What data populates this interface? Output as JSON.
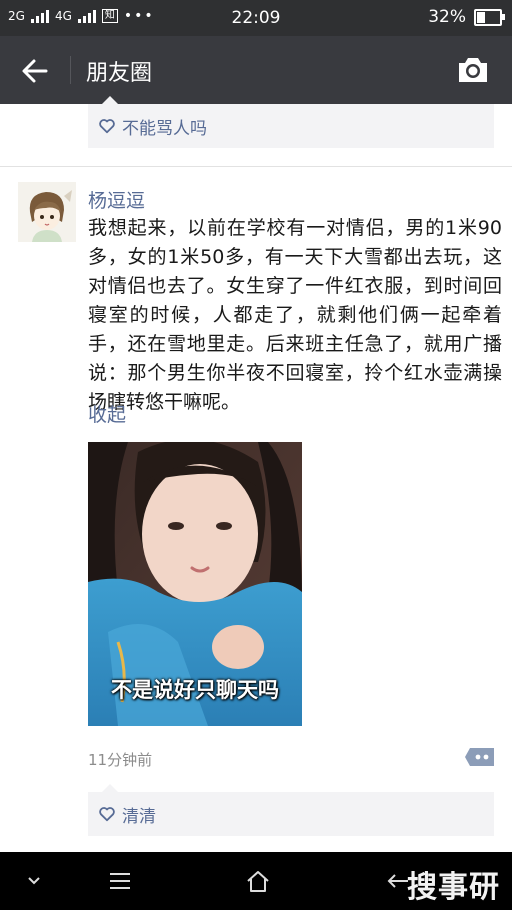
{
  "status_bar": {
    "network_1": "2G",
    "network_2": "4G",
    "network_2_sub": "4G",
    "app_badge": "知",
    "dots": "•••",
    "time": "22:09",
    "battery_text": "32%",
    "battery_level": 0.32
  },
  "nav": {
    "title": "朋友圈"
  },
  "previous_post": {
    "likes": "不能骂人吗"
  },
  "post": {
    "author": "杨逗逗",
    "text": "我想起来，以前在学校有一对情侣，男的1米90多，女的1米50多，有一天下大雪都出去玩，这对情侣也去了。女生穿了一件红衣服，到时间回寝室的时候，人都走了，就剩他们俩一起牵着手，还在雪地里走。后来班主任急了，就用广播说：那个男生你半夜不回寝室，拎个红水壶满操场瞎转悠干嘛呢。",
    "collapse_label": "收起",
    "image_caption": "不是说好只聊天吗",
    "timestamp": "11分钟前",
    "likes": "清清"
  },
  "watermark": "搜事研",
  "colors": {
    "link": "#576b95",
    "nav_bg": "#393a3f",
    "status_bg": "#2f3032"
  }
}
